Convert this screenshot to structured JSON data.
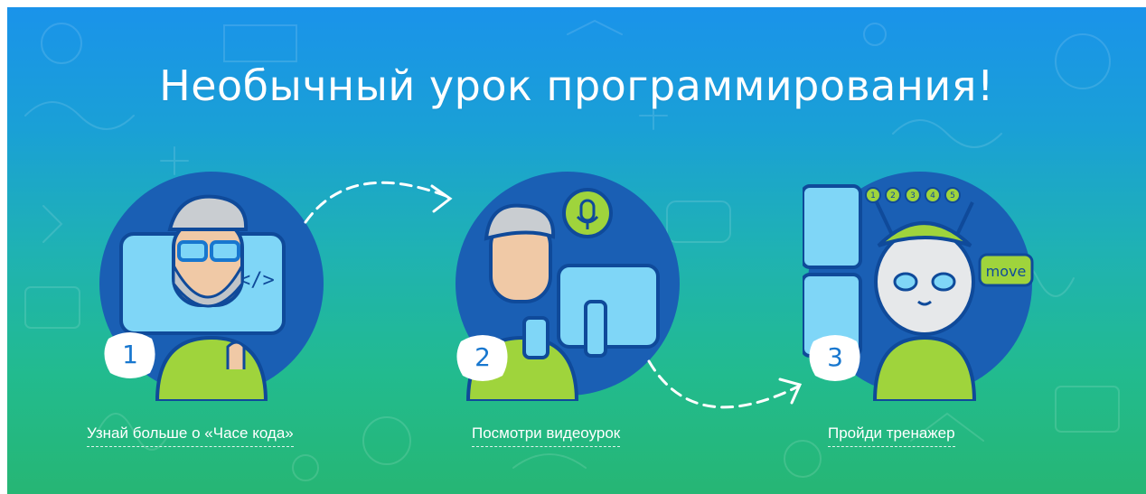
{
  "hero": {
    "title": "Необычный урок программирования!",
    "steps": [
      {
        "number": "1",
        "link": "Узнай больше о «Часе кода»"
      },
      {
        "number": "2",
        "link": "Посмотри видеоурок"
      },
      {
        "number": "3",
        "link": "Пройди тренажер"
      }
    ],
    "illustration_texts": {
      "code_tag": "</>",
      "speech_bubble": "move",
      "dots": [
        "1",
        "2",
        "3",
        "4",
        "5"
      ]
    }
  },
  "colors": {
    "gradient_top": "#1a93ea",
    "gradient_bottom": "#26b674",
    "circle_dark": "#1a5fb4",
    "accent_green": "#9fd43c",
    "screen_light": "#7fd6f7"
  },
  "icons": [
    "developer-icon",
    "video-lesson-icon",
    "cat-trainer-icon",
    "dashed-arrow-icon",
    "microphone-icon"
  ]
}
